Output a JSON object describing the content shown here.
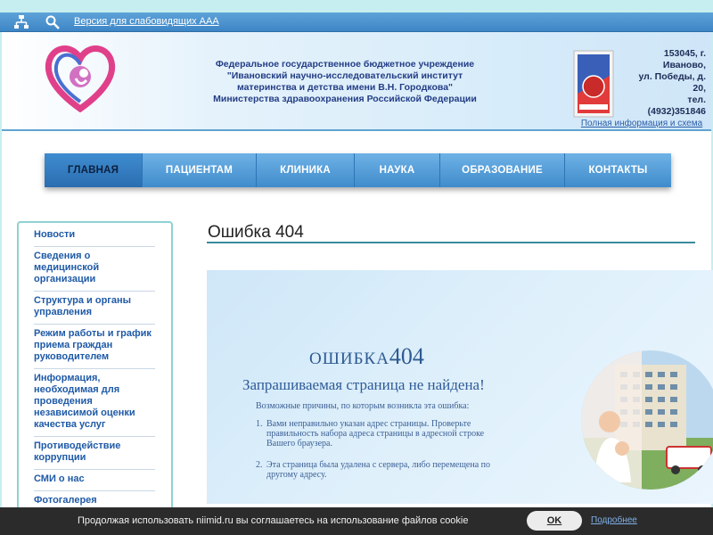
{
  "topbar": {
    "sitemap_icon": "sitemap-icon",
    "search_icon": "search-icon",
    "accessibility_link": "Версия для слабовидящих AAA"
  },
  "header": {
    "org_lines": [
      "Федеральное государственное бюджетное учреждение",
      "\"Ивановский научно-исследовательский институт",
      "материнства и детства имени В.Н. Городкова\"",
      "Министерства здравоохранения Российской Федерации"
    ],
    "contact_lines": [
      "153045, г.",
      "Иваново,",
      "ул. Победы, д.",
      "20,",
      "тел.",
      "(4932)351846"
    ],
    "contact_more": "Полная информация и схема проезда"
  },
  "nav": {
    "items": [
      {
        "label": "ГЛАВНАЯ",
        "active": true
      },
      {
        "label": "ПАЦИЕНТАМ",
        "active": false
      },
      {
        "label": "КЛИНИКА",
        "active": false
      },
      {
        "label": "НАУКА",
        "active": false
      },
      {
        "label": "ОБРАЗОВАНИЕ",
        "active": false
      },
      {
        "label": "КОНТАКТЫ",
        "active": false
      }
    ]
  },
  "sidebar": {
    "items": [
      "Новости",
      "Сведения о медицинской организации",
      "Структура и органы управления",
      "Режим работы и график приема граждан руководителем",
      "Информация, необходимая для проведения независимой оценки качества услуг",
      "Противодействие коррупции",
      "СМИ о нас",
      "Фотогалерея"
    ]
  },
  "main": {
    "title": "Ошибка 404",
    "banner": {
      "heading_word": "ошибка",
      "heading_code": "404",
      "subheading": "Запрашиваемая страница не найдена!",
      "reasons_intro": "Возможные причины, по которым возникла эта ошибка:",
      "reasons": [
        {
          "num": "1.",
          "text": "Вами неправильно указан адрес страницы. Проверьте правильность набора адреса страницы в адресной строке Вашего браузера."
        },
        {
          "num": "2.",
          "text": "Эта страница была удалена с сервера, либо перемещена по другому адресу."
        }
      ]
    }
  },
  "cookie": {
    "text": "Продолжая использовать niimid.ru вы соглашаетесь на использование файлов cookie",
    "ok": "OK",
    "more": "Подробнее"
  },
  "colors": {
    "accent": "#3f8ccb",
    "link": "#1f5aa7",
    "sidebar_border": "#8fd2d3"
  }
}
